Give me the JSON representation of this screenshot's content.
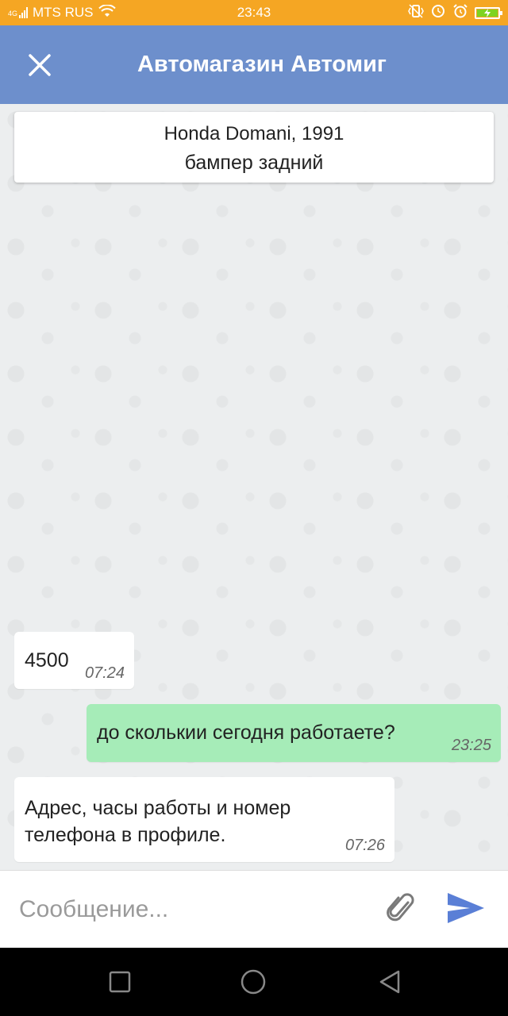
{
  "status_bar": {
    "carrier": "MTS RUS",
    "network_label": "4G",
    "time": "23:43",
    "icons": [
      "signal-icon",
      "wifi-icon",
      "vibrate-icon",
      "alarm-icon",
      "clock-icon",
      "battery-charging-icon"
    ],
    "color": "#f5a623"
  },
  "header": {
    "title": "Автомагазин Автомиг",
    "close_icon": "close-icon",
    "color": "#6d8fcc"
  },
  "context": {
    "car": "Honda Domani, 1991",
    "part": "бампер задний"
  },
  "messages": [
    {
      "direction": "incoming",
      "text": "4500",
      "time": "07:24"
    },
    {
      "direction": "outgoing",
      "text": "до сколькии сегодня работаете?",
      "time": "23:25"
    },
    {
      "direction": "incoming",
      "text": "Адрес, часы работы и номер телефона в профиле.",
      "time": "07:26"
    }
  ],
  "composer": {
    "value": "",
    "placeholder": "Сообщение...",
    "attach_icon": "paperclip-icon",
    "send_icon": "send-icon",
    "send_color": "#5a7fd6"
  },
  "nav_bar": {
    "buttons": [
      "recent-apps-icon",
      "home-icon",
      "back-icon"
    ]
  },
  "colors": {
    "outgoing_bubble": "#a6ecb8",
    "incoming_bubble": "#ffffff"
  }
}
